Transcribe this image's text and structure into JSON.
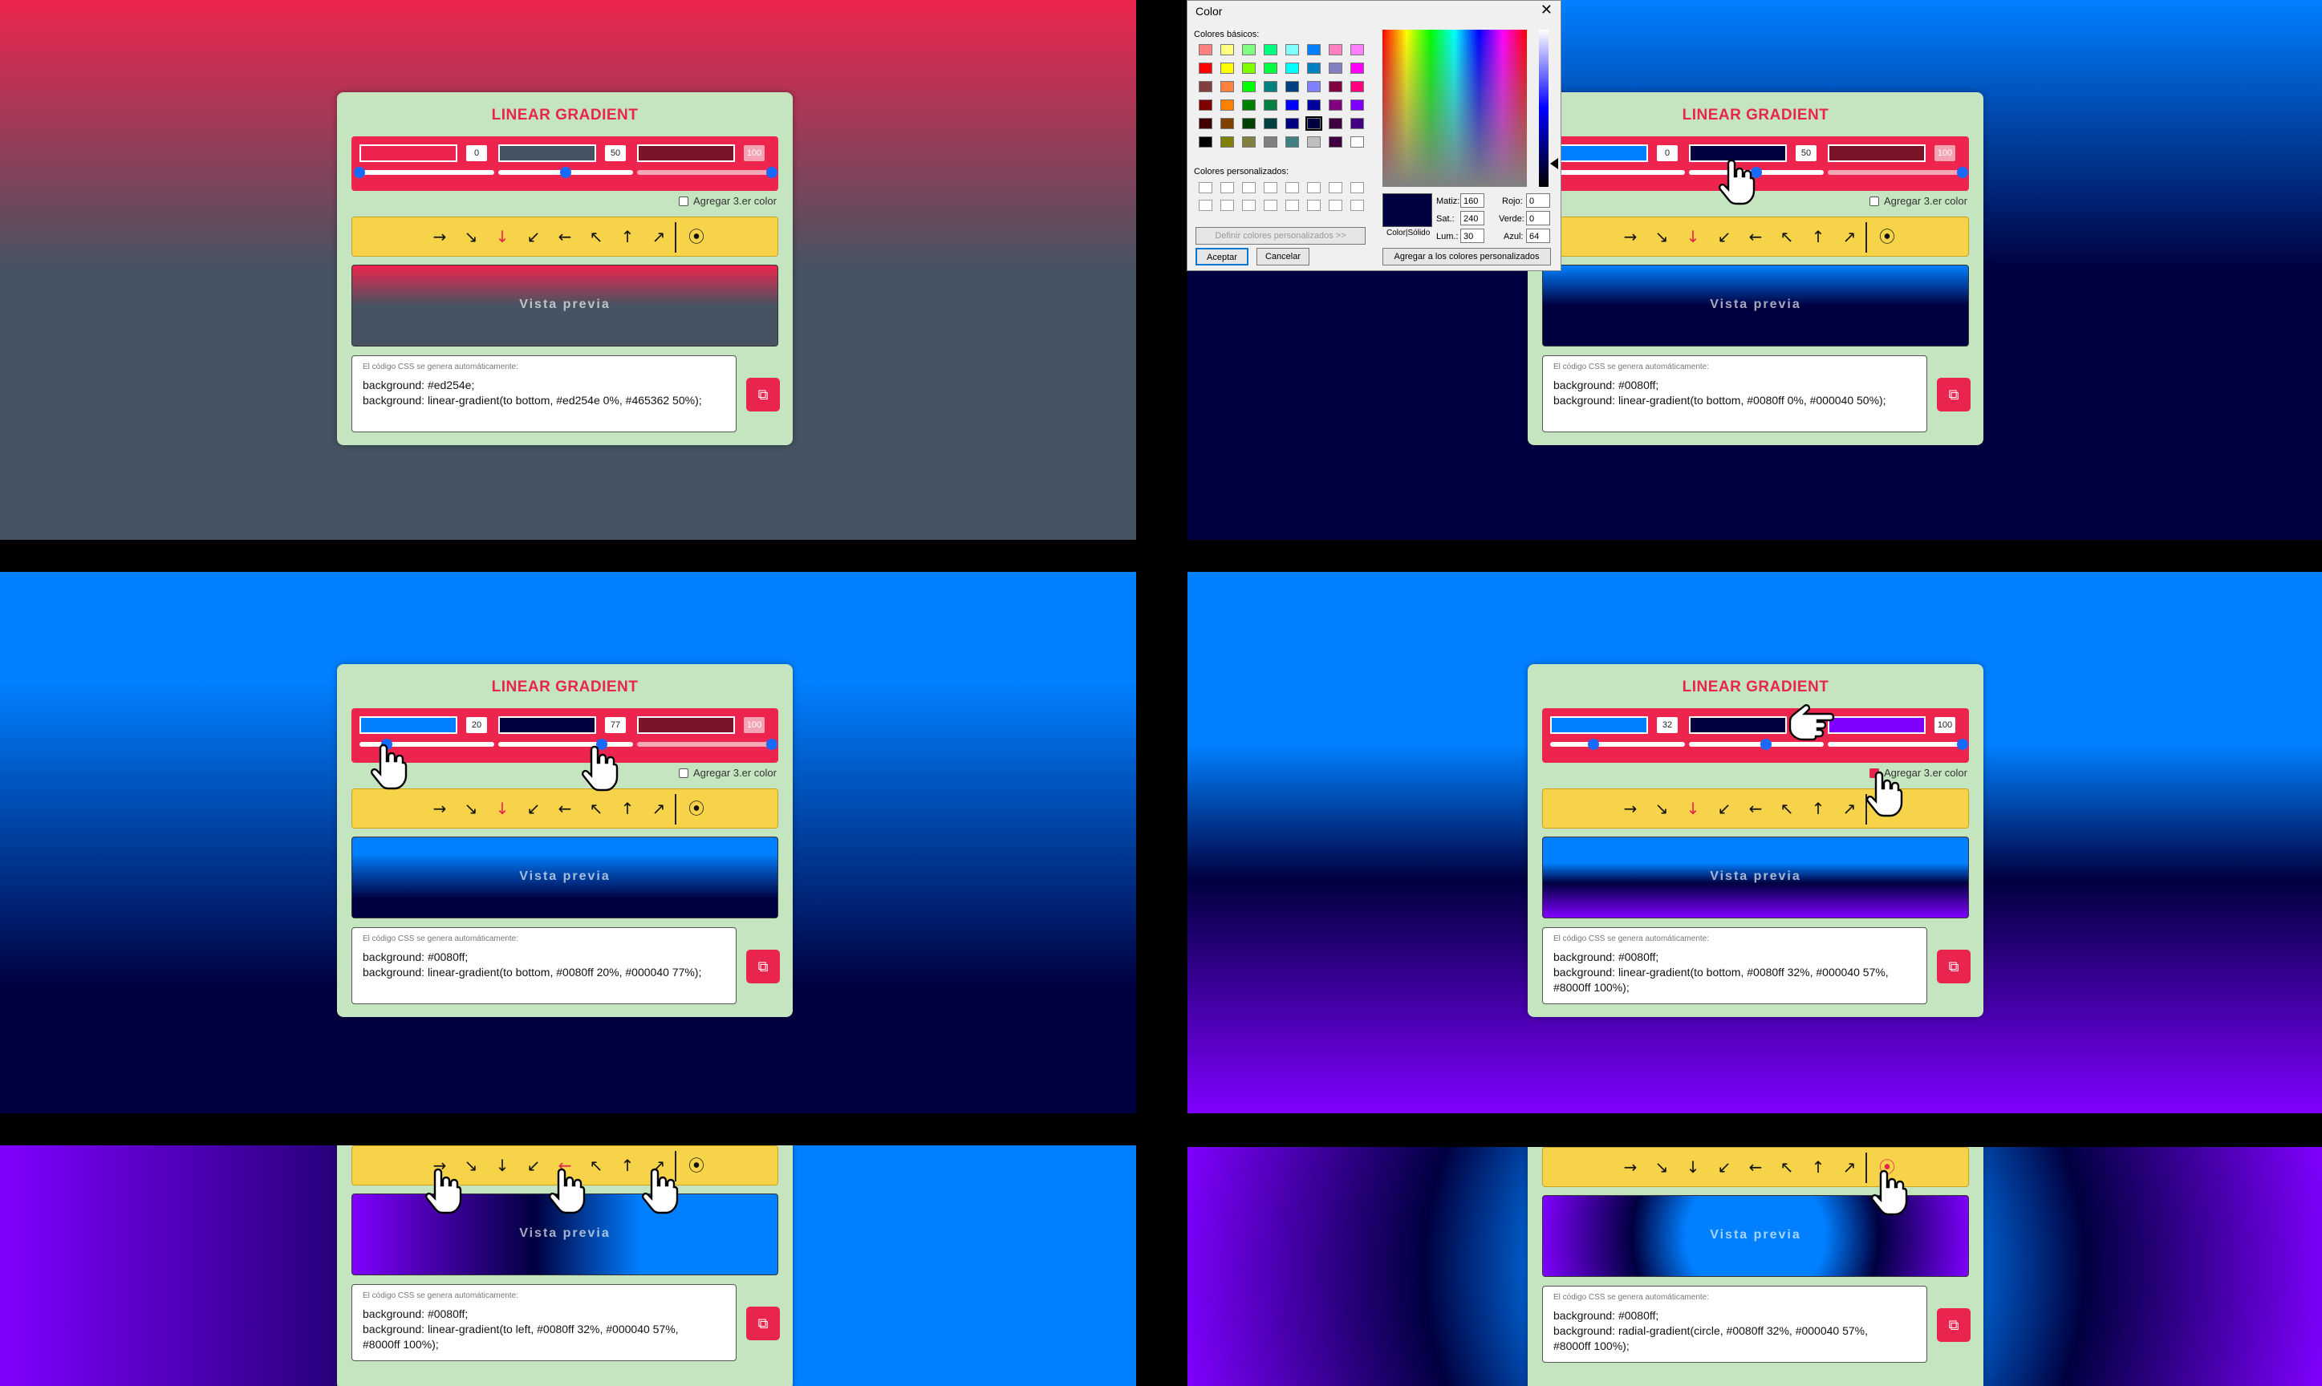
{
  "app": {
    "title": "LINEAR GRADIENT",
    "third_color_label": "Agregar 3.er color",
    "preview_label": "Vista previa",
    "code_hint": "El código CSS se genera automáticamente:",
    "directions": [
      "→",
      "↘",
      "↓",
      "↙",
      "←",
      "↖",
      "↑",
      "↗"
    ],
    "radial_icon": "⦿",
    "copy_icon": "⧉"
  },
  "colors": {
    "accent": "#ed254e",
    "card": "#c5e5c0",
    "toolbar": "#f7d349",
    "slate": "#465362",
    "blue": "#0080ff",
    "navy": "#000040",
    "violet": "#8000ff",
    "maroon": "#7a1428"
  },
  "panels": [
    {
      "stops": [
        {
          "color": "#ed254e",
          "pos": "0"
        },
        {
          "color": "#465362",
          "pos": "50"
        },
        {
          "color": "#7a1428",
          "pos": "100",
          "disabled": true
        }
      ],
      "third_checked": false,
      "active_dir": 2,
      "code": [
        "background: #ed254e;",
        "background: linear-gradient(to bottom, #ed254e 0%, #465362 50%);"
      ]
    },
    {
      "stops": [
        {
          "color": "#0080ff",
          "pos": "0"
        },
        {
          "color": "#000040",
          "pos": "50"
        },
        {
          "color": "#7a1428",
          "pos": "100",
          "disabled": true
        }
      ],
      "third_checked": false,
      "active_dir": 2,
      "code": [
        "background: #0080ff;",
        "background: linear-gradient(to bottom, #0080ff 0%, #000040 50%);"
      ]
    },
    {
      "stops": [
        {
          "color": "#0080ff",
          "pos": "20"
        },
        {
          "color": "#000040",
          "pos": "77"
        },
        {
          "color": "#7a1428",
          "pos": "100",
          "disabled": true
        }
      ],
      "third_checked": false,
      "active_dir": 2,
      "code": [
        "background: #0080ff;",
        "background: linear-gradient(to bottom, #0080ff 20%, #000040 77%);"
      ]
    },
    {
      "stops": [
        {
          "color": "#0080ff",
          "pos": "32"
        },
        {
          "color": "#000040",
          "pos": "57"
        },
        {
          "color": "#8000ff",
          "pos": "100"
        }
      ],
      "third_checked": true,
      "active_dir": 2,
      "code": [
        "background: #0080ff;",
        "background: linear-gradient(to bottom, #0080ff 32%, #000040 57%,",
        "#8000ff 100%);"
      ]
    },
    {
      "active_dir": 4,
      "code": [
        "background: #0080ff;",
        "background: linear-gradient(to left, #0080ff 32%, #000040 57%,",
        "#8000ff 100%);"
      ]
    },
    {
      "active_dir": 8,
      "code": [
        "background: #0080ff;",
        "background: radial-gradient(circle, #0080ff 32%, #000040 57%,",
        "#8000ff 100%);"
      ]
    }
  ],
  "color_dialog": {
    "title": "Color",
    "close": "✕",
    "basic_label": "Colores básicos:",
    "custom_label": "Colores personalizados:",
    "define_btn": "Definir colores personalizados >>",
    "ok_btn": "Aceptar",
    "cancel_btn": "Cancelar",
    "add_btn": "Agregar a los colores personalizados",
    "solid_label": "Color|Sólido",
    "hue_label": "Matiz:",
    "hue": "160",
    "sat_label": "Sat.:",
    "sat": "240",
    "lum_label": "Lum.:",
    "lum": "30",
    "red_label": "Rojo:",
    "red": "0",
    "green_label": "Verde:",
    "green": "0",
    "blue_label": "Azul:",
    "blue": "64",
    "basic_colors": [
      "#ff8080",
      "#ffff80",
      "#80ff80",
      "#00ff80",
      "#80ffff",
      "#0080ff",
      "#ff80c0",
      "#ff80ff",
      "#ff0000",
      "#ffff00",
      "#80ff00",
      "#00ff40",
      "#00ffff",
      "#0080c0",
      "#8080c0",
      "#ff00ff",
      "#804040",
      "#ff8040",
      "#00ff00",
      "#008080",
      "#004080",
      "#8080ff",
      "#800040",
      "#ff0080",
      "#800000",
      "#ff8000",
      "#008000",
      "#008040",
      "#0000ff",
      "#0000a0",
      "#800080",
      "#8000ff",
      "#400000",
      "#804000",
      "#004000",
      "#004040",
      "#000080",
      "#000040",
      "#400040",
      "#400080",
      "#000000",
      "#808000",
      "#808040",
      "#808080",
      "#408080",
      "#c0c0c0",
      "#400040",
      "#ffffff"
    ]
  }
}
